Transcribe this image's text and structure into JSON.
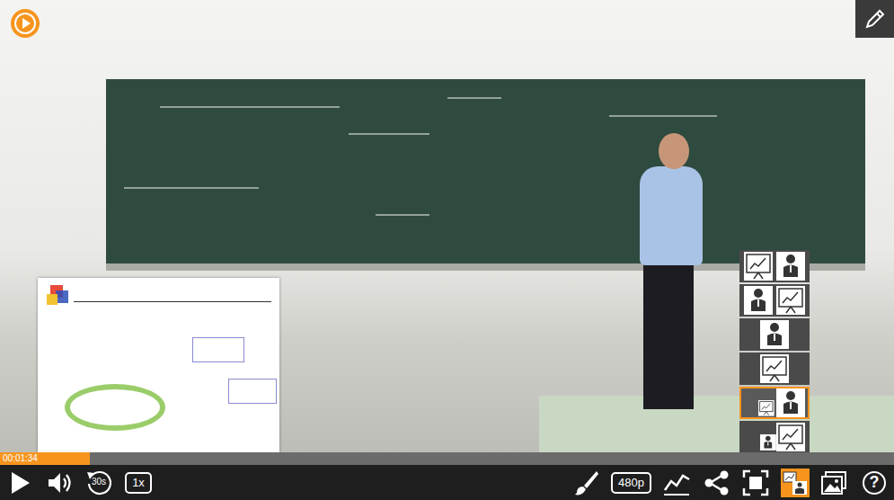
{
  "player": {
    "time": "00:01:34",
    "progress": 0.1,
    "playing": false
  },
  "controls_left": [
    {
      "kind": "play"
    },
    {
      "kind": "volume"
    },
    {
      "kind": "replay",
      "label": "30s"
    },
    {
      "kind": "speed",
      "label": "1x"
    }
  ],
  "controls_right": [
    {
      "kind": "brush",
      "selected": false
    },
    {
      "kind": "quality",
      "label": "480p",
      "selected": false
    },
    {
      "kind": "stats",
      "selected": false
    },
    {
      "kind": "share",
      "selected": false
    },
    {
      "kind": "fullscreen",
      "selected": false
    },
    {
      "kind": "layout",
      "selected": true
    },
    {
      "kind": "image",
      "selected": false
    },
    {
      "kind": "help",
      "label": "?",
      "selected": false
    }
  ],
  "layouts": [
    {
      "kind": "slides-presenter",
      "selected": false
    },
    {
      "kind": "presenter-slides",
      "selected": false
    },
    {
      "kind": "presenter",
      "selected": false
    },
    {
      "kind": "slides",
      "selected": false
    },
    {
      "kind": "pip-slides",
      "selected": true
    },
    {
      "kind": "pip-presenter",
      "selected": false
    }
  ]
}
